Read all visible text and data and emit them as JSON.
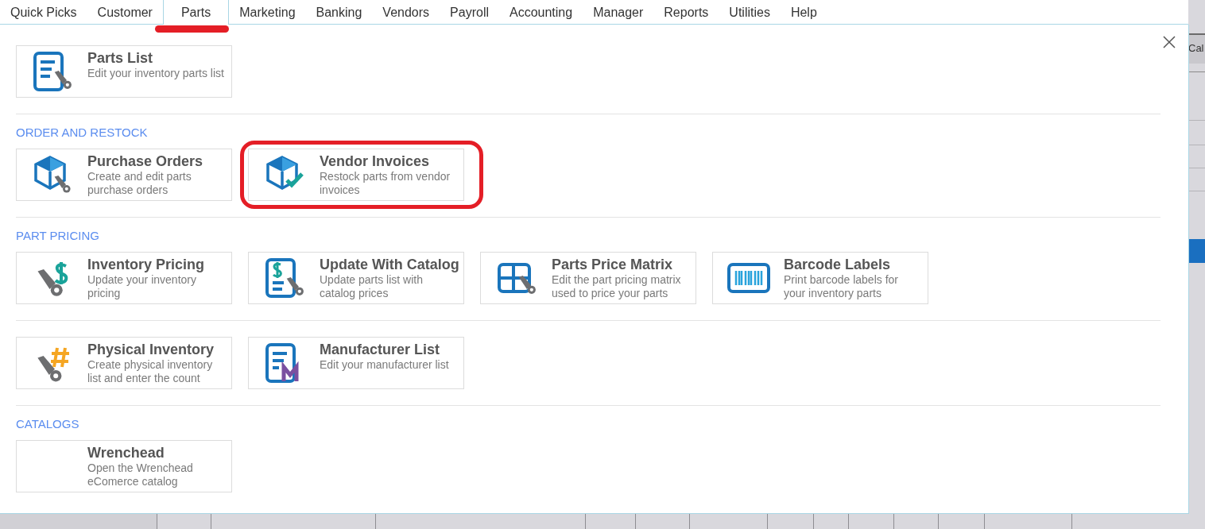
{
  "menu_tabs": [
    {
      "label": "Quick Picks",
      "selected": false
    },
    {
      "label": "Customer",
      "selected": false
    },
    {
      "label": "Parts",
      "selected": true
    },
    {
      "label": "Marketing",
      "selected": false
    },
    {
      "label": "Banking",
      "selected": false
    },
    {
      "label": "Vendors",
      "selected": false
    },
    {
      "label": "Payroll",
      "selected": false
    },
    {
      "label": "Accounting",
      "selected": false
    },
    {
      "label": "Manager",
      "selected": false
    },
    {
      "label": "Reports",
      "selected": false
    },
    {
      "label": "Utilities",
      "selected": false
    },
    {
      "label": "Help",
      "selected": false
    }
  ],
  "background": {
    "column_header": "Cal"
  },
  "groups": [
    {
      "cards": [
        {
          "kind": "list-doc",
          "title": "Parts List",
          "description": "Edit your inventory parts list",
          "highlighted": false
        }
      ]
    },
    {
      "heading": "ORDER AND RESTOCK",
      "cards": [
        {
          "kind": "box-part",
          "title": "Purchase Orders",
          "description": "Create and edit parts purchase orders",
          "highlighted": false
        },
        {
          "kind": "box-check",
          "title": "Vendor Invoices",
          "description": "Restock parts from vendor invoices",
          "highlighted": true
        }
      ]
    },
    {
      "heading": "PART PRICING",
      "cards": [
        {
          "kind": "part-dollar",
          "title": "Inventory Pricing",
          "description": "Update your inventory pricing",
          "highlighted": false
        },
        {
          "kind": "doc-dollar",
          "title": "Update With Catalog",
          "description": "Update parts list with catalog prices",
          "highlighted": false
        },
        {
          "kind": "matrix",
          "title": "Parts Price Matrix",
          "description": "Edit the part pricing matrix used to price your parts",
          "highlighted": false
        },
        {
          "kind": "barcode",
          "title": "Barcode Labels",
          "description": "Print barcode labels for your inventory parts",
          "highlighted": false
        }
      ]
    },
    {
      "cards": [
        {
          "kind": "part-hash",
          "title": "Physical Inventory",
          "description": "Create physical inventory list and enter the count",
          "highlighted": false
        },
        {
          "kind": "doc-m",
          "title": "Manufacturer List",
          "description": "Edit your manufacturer list",
          "highlighted": false
        }
      ]
    },
    {
      "heading": "CATALOGS",
      "cards": [
        {
          "kind": "blank",
          "title": "Wrenchead",
          "description": "Open the Wrenchead eComerce catalog",
          "highlighted": false
        }
      ]
    }
  ]
}
